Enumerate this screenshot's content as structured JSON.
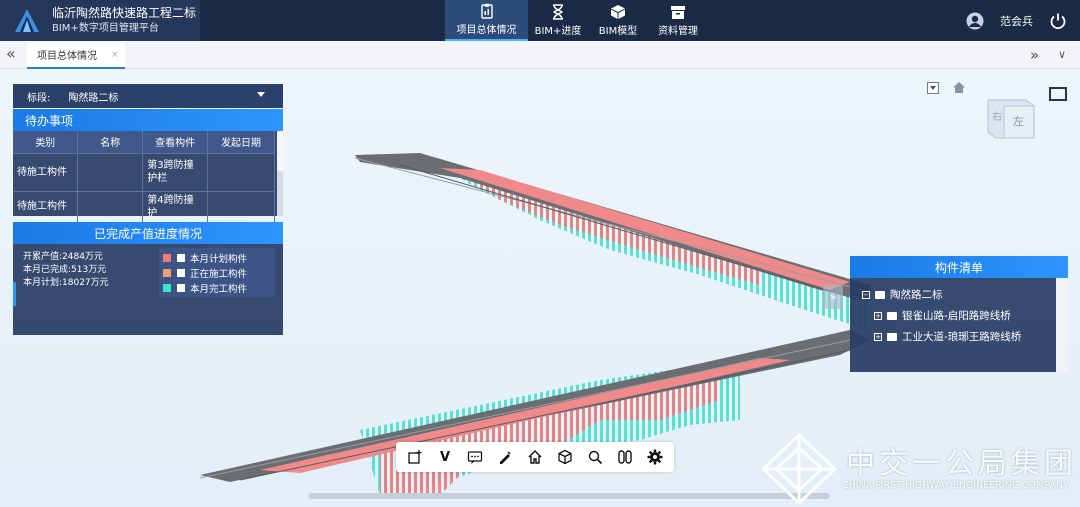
{
  "header": {
    "title": "临沂陶然路快速路工程二标",
    "subtitle": "BIM+数字项目管理平台",
    "nav": [
      {
        "label": "项目总体情况",
        "icon": "overview-icon",
        "active": true
      },
      {
        "label": "BIM+进度",
        "icon": "hourglass-icon"
      },
      {
        "label": "BIM模型",
        "icon": "cube-icon"
      },
      {
        "label": "资料管理",
        "icon": "archive-icon"
      }
    ],
    "user_name": "范会兵"
  },
  "tabs": {
    "active_label": "项目总体情况",
    "close": "×"
  },
  "segment": {
    "label": "标段:",
    "value": "陶然路二标"
  },
  "todo": {
    "title": "待办事项",
    "columns": [
      "类别",
      "名称",
      "查看构件",
      "发起日期"
    ],
    "rows": [
      [
        "待施工构件",
        "",
        "第3跨防撞护栏",
        ""
      ],
      [
        "待施工构件",
        "",
        "第4跨防撞护",
        ""
      ]
    ]
  },
  "progress": {
    "title": "已完成产值进度情况",
    "stats": [
      "开累产值:2484万元",
      "本月已完成:513万元",
      "本月计划:18027万元"
    ],
    "legend": [
      {
        "label": "本月计划构件",
        "color": "#f07a7a"
      },
      {
        "label": "正在施工构件",
        "color": "#f0a070"
      },
      {
        "label": "本月完工构件",
        "color": "#3ee0c8"
      }
    ]
  },
  "parts": {
    "title": "构件清单",
    "tree": [
      {
        "label": "陶然路二标",
        "expand": "−",
        "level": 0
      },
      {
        "label": "银雀山路-启阳路跨线桥",
        "expand": "+",
        "level": 1
      },
      {
        "label": "工业大道-琅琊王路跨线桥",
        "expand": "+",
        "level": 1
      }
    ]
  },
  "viewcube": {
    "faces": [
      "右",
      "左"
    ]
  },
  "toolbar": {
    "tools": [
      "select-box-icon",
      "v-measure-icon",
      "comment-icon",
      "pen-icon",
      "home-view-icon",
      "cube-view-icon",
      "search-icon",
      "section-icon",
      "settings-icon"
    ],
    "v_label": "V"
  },
  "watermark": {
    "cn": "中交一公局集团",
    "en": "CHINA FIRST HIGHWAY ENGINEERING COMPANY"
  },
  "colors": {
    "header_bg": "#1b2a45",
    "accent": "#2e95ff",
    "panel_bg": "#273c63",
    "planned": "#f07a7a",
    "completed": "#3ee0c8",
    "bridge_deck": "#6f6f6f"
  }
}
